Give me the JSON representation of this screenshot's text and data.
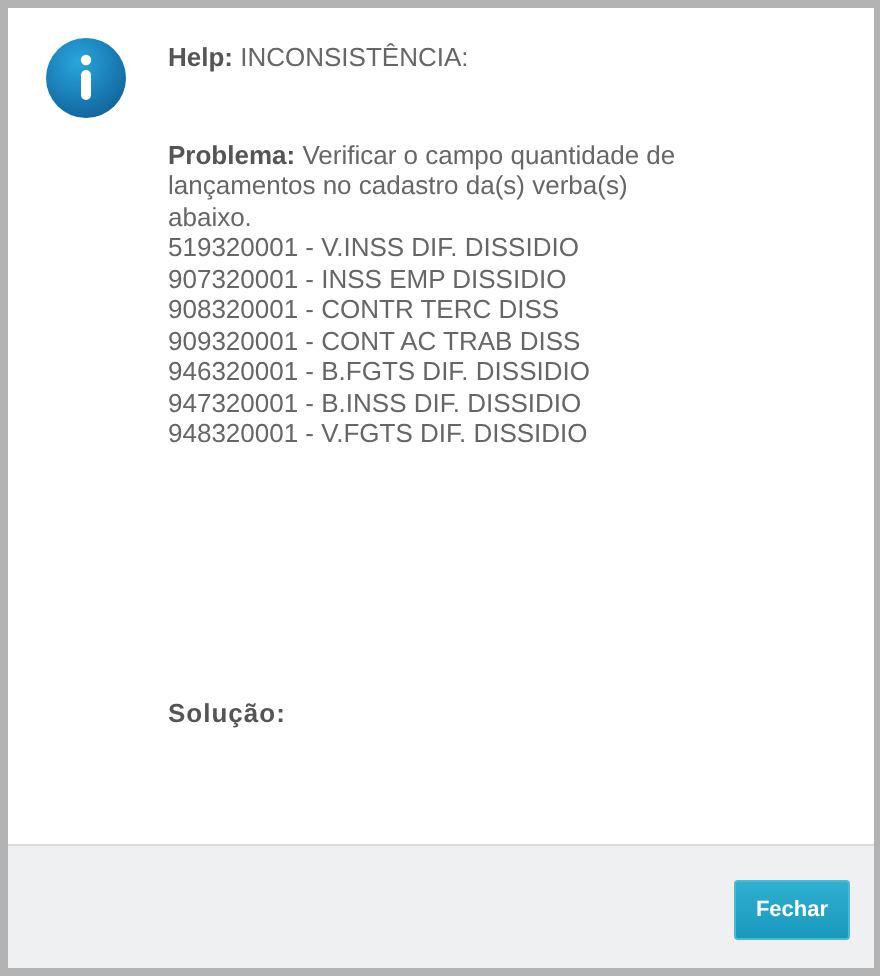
{
  "dialog": {
    "help": "**Help:** INCONSISTÊNCIA:",
    "problem": "**Problema:** Verificar o campo quantidade de lançamentos no cadastro da(s) verba(s) abaixo.",
    "items": [
      "519320001 - V.INSS DIF. DISSIDIO",
      "907320001 - INSS EMP DISSIDIO",
      "908320001 - CONTR TERC DISS",
      "909320001 - CONT AC TRAB DISS",
      "946320001 - B.FGTS DIF. DISSIDIO",
      "947320001 - B.INSS DIF. DISSIDIO",
      "948320001 - V.FGTS DIF. DISSIDIO"
    ],
    "solution_label": "Solução:",
    "buttons": [
      "Fechar"
    ]
  }
}
